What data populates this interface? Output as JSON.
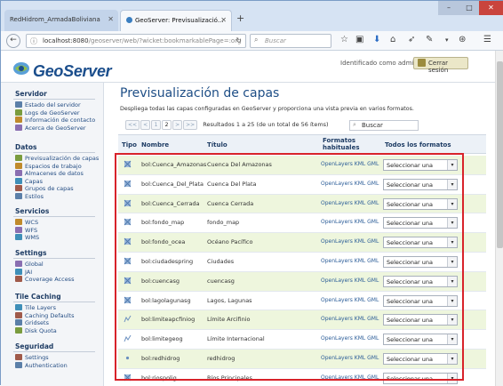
{
  "browser": {
    "tabs": [
      {
        "label": "RedHidrom_ArmadaBoliviana"
      },
      {
        "label": "GeoServer: Previsualizació..."
      }
    ],
    "url_host": "localhost:8080",
    "url_path": "/geoserver/web/?wicket:bookmarkablePage=:org",
    "search_placeholder": "Buscar"
  },
  "header": {
    "logo_text": "GeoServer",
    "identified_as": "Identificado como admin.",
    "logout_label": "Cerrar sesión"
  },
  "sidebar": {
    "sections": [
      {
        "title": "Servidor",
        "items": [
          "Estado del servidor",
          "Logs de GeoServer",
          "Información de contacto",
          "Acerca de GeoServer"
        ]
      },
      {
        "title": "Datos",
        "items": [
          "Previsualización de capas",
          "Espacios de trabajo",
          "Almacenes de datos",
          "Capas",
          "Grupos de capas",
          "Estilos"
        ]
      },
      {
        "title": "Servicios",
        "items": [
          "WCS",
          "WFS",
          "WMS"
        ]
      },
      {
        "title": "Settings",
        "items": [
          "Global",
          "JAI",
          "Coverage Access"
        ]
      },
      {
        "title": "Tile Caching",
        "items": [
          "Tile Layers",
          "Caching Defaults",
          "Gridsets",
          "Disk Quota"
        ]
      },
      {
        "title": "Seguridad",
        "items": [
          "Settings",
          "Authentication"
        ]
      }
    ]
  },
  "main": {
    "title": "Previsualización de capas",
    "description": "Despliega todas las capas configuradas en GeoServer y proporciona una vista previa en varios formatos.",
    "pager": {
      "buttons": [
        "<<",
        "<",
        "1",
        "2",
        ">",
        ">>"
      ],
      "current": "1",
      "results": "Resultados 1 a 25 (de un total de 56 ítems)"
    },
    "search_label": "Buscar",
    "columns": {
      "tipo": "Tipo",
      "nombre": "Nombre",
      "titulo": "Título",
      "formatos": "Formatos habituales",
      "todos": "Todos los formatos"
    },
    "select_value": "Seleccionar una",
    "rows": [
      {
        "type": "raster",
        "name": "bol:Cuenca_Amazonas",
        "title": "Cuenca Del Amazonas",
        "formats": "OpenLayers KML GML"
      },
      {
        "type": "raster",
        "name": "bol:Cuenca_Del_Plata",
        "title": "Cuenca Del Plata",
        "formats": "OpenLayers KML GML"
      },
      {
        "type": "raster",
        "name": "bol:Cuenca_Cerrada",
        "title": "Cuenca Cerrada",
        "formats": "OpenLayers KML GML"
      },
      {
        "type": "raster",
        "name": "bol:fondo_map",
        "title": "fondo_map",
        "formats": "OpenLayers KML GML"
      },
      {
        "type": "raster",
        "name": "bol:fondo_ocea",
        "title": "Océano Pacífico",
        "formats": "OpenLayers KML GML"
      },
      {
        "type": "raster",
        "name": "bol:ciudadespring",
        "title": "Ciudades",
        "formats": "OpenLayers KML GML"
      },
      {
        "type": "raster",
        "name": "bol:cuencasg",
        "title": "cuencasg",
        "formats": "OpenLayers KML GML"
      },
      {
        "type": "raster",
        "name": "bol:lagolagunasg",
        "title": "Lagos, Lagunas",
        "formats": "OpenLayers KML GML"
      },
      {
        "type": "line",
        "name": "bol:limiteарcfiniog",
        "title": "Límite Arcifinio",
        "formats": "OpenLayers KML GML"
      },
      {
        "type": "line",
        "name": "bol:limitegeog",
        "title": "Límite Internacional",
        "formats": "OpenLayers KML GML"
      },
      {
        "type": "point",
        "name": "bol:redhidrog",
        "title": "redhidrog",
        "formats": "OpenLayers KML GML"
      },
      {
        "type": "raster",
        "name": "bol:riospolig",
        "title": "Ríos Principales",
        "formats": "OpenLayers KML GML"
      }
    ]
  },
  "colors": {
    "accent": "#1e4e86",
    "highlight_box": "#d8232a",
    "row_alt": "#eef6dd"
  }
}
